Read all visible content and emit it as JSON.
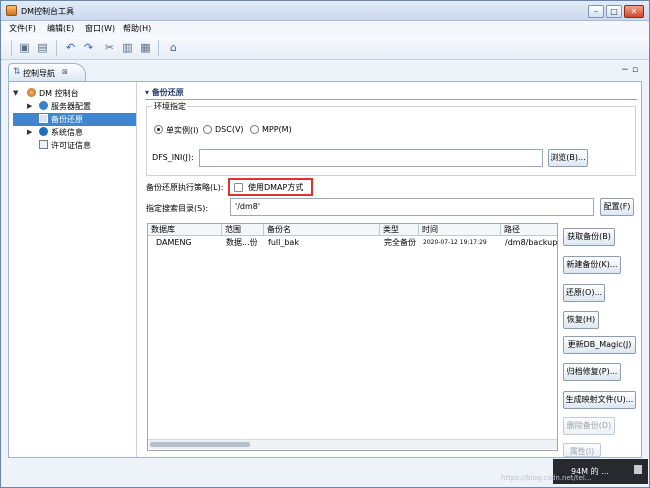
{
  "window": {
    "title": "DM控制台工具",
    "min_label": "▭",
    "max_label": "▭",
    "close_label": "✕"
  },
  "menu": [
    "文件(F)",
    "编辑(E)",
    "窗口(W)",
    "帮助(H)"
  ],
  "toolbar_icons": [
    "save-icon",
    "save-all-icon",
    "undo-icon",
    "redo-icon",
    "cut-icon",
    "copy-icon",
    "paste-icon",
    "home-icon"
  ],
  "nav": {
    "tab_label": "控制导航",
    "tab_close": "⊠",
    "tree": [
      {
        "label": "DM 控制台",
        "icon": "console-icon"
      },
      {
        "label": "服务器配置",
        "icon": "server-config-icon"
      },
      {
        "label": "备份还原",
        "icon": "backup-icon",
        "selected": true
      },
      {
        "label": "系统信息",
        "icon": "info-icon"
      },
      {
        "label": "许可证信息",
        "icon": "license-icon"
      }
    ]
  },
  "backup": {
    "section_title": "备份还原",
    "env_group": "环境指定",
    "radio_single": "单实例(I)",
    "radio_dsc": "DSC(V)",
    "radio_mpp": "MPP(M)",
    "dfs_label": "DFS_INI(J):",
    "dfs_value": "",
    "browse_button": "浏览(B)...",
    "strategy_label": "备份还原执行策略(L):",
    "dmap_checkbox": "使用DMAP方式",
    "dmap_checked": false,
    "search_dir_label": "指定搜索目录(S):",
    "search_dir_value": "'/dm8'",
    "config_button": "配置(F)",
    "columns": [
      "数据库",
      "范围",
      "备份名",
      "类型",
      "时间",
      "路径"
    ],
    "rows": [
      {
        "db": "DAMENG",
        "scope": "数据...份",
        "name": "full_bak",
        "type": "完全备份",
        "time": "2020-07-12 19:17:29",
        "path": "/dm8/backup"
      }
    ],
    "side_buttons": [
      {
        "label": "获取备份(B)",
        "enabled": true
      },
      {
        "label": "新建备份(K)...",
        "enabled": true
      },
      {
        "label": "还原(O)...",
        "enabled": true
      },
      {
        "label": "恢复(H)",
        "enabled": true
      },
      {
        "label": "更新DB_Magic(J)",
        "enabled": true
      },
      {
        "label": "归档修复(P)...",
        "enabled": true
      },
      {
        "label": "生成映射文件(U)...",
        "enabled": true
      },
      {
        "label": "删除备份(D)",
        "enabled": false
      },
      {
        "label": "属性(I)",
        "enabled": false
      }
    ]
  },
  "status": {
    "memory": "94M 的 ...",
    "watermark": "https://blog.csdn.net/tel..."
  }
}
